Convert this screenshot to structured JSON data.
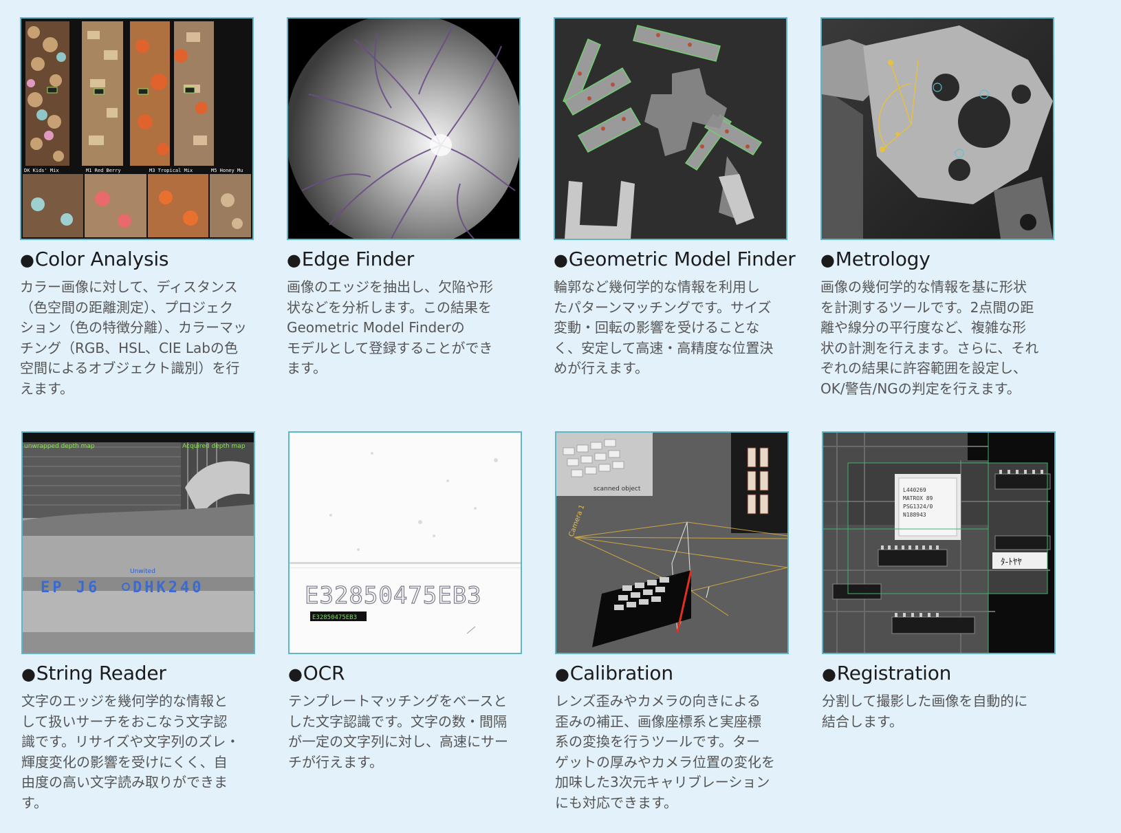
{
  "cards": [
    {
      "title": "Color Analysis",
      "image": "color-analysis-cereal-image",
      "image_labels": [
        "DK Kids' Mix",
        "M1 Red Berry",
        "M3 Tropical Mix",
        "M5 Honey Mu"
      ],
      "description": [
        "カラー画像に対して、ディスタンス",
        "（色空間の距離測定）、プロジェク",
        "ション（色の特徴分離）、カラーマッ",
        "チング（RGB、HSL、CIE Labの色",
        "空間によるオブジェクト識別）を行",
        "えます。"
      ]
    },
    {
      "title": "Edge Finder",
      "image": "retina-vessel-image",
      "image_labels": [],
      "description": [
        "画像のエッジを抽出し、欠陥や形",
        "状などを分析します。この結果を",
        "Geometric Model Finderの",
        "モデルとして登録することができ",
        "ます。"
      ]
    },
    {
      "title": "Geometric Model Finder",
      "image": "metal-brackets-image",
      "image_labels": [],
      "description": [
        "輪郭など幾何学的な情報を利用し",
        "たパターンマッチングです。サイズ",
        "変動・回転の影響を受けることな",
        "く、安定して高速・高精度な位置決",
        "めが行えます。"
      ]
    },
    {
      "title": "Metrology",
      "image": "metal-part-measurement-image",
      "image_labels": [],
      "description": [
        "画像の幾何学的な情報を基に形状",
        "を計測するツールです。2点間の距",
        "離や線分の平行度など、複雑な形",
        "状の計測を行えます。さらに、それ",
        "ぞれの結果に許容範囲を設定し、",
        "OK/警告/NGの判定を行えます。"
      ]
    },
    {
      "title": "String Reader",
      "image": "tire-depth-map-image",
      "image_labels": [
        "unwrapped depth map",
        "Acquired depth map",
        "Unwited",
        "EP J6",
        "DHK240"
      ],
      "description": [
        "文字のエッジを幾何学的な情報と",
        "して扱いサーチをおこなう文字認",
        "識です。リサイズや文字列のズレ・",
        "輝度変化の影響を受けにくく、自",
        "由度の高い文字読み取りができま",
        "す。"
      ]
    },
    {
      "title": "OCR",
      "image": "ocr-dot-matrix-image",
      "image_labels": [
        "E32850475EB3",
        "E32850475EB3"
      ],
      "description": [
        "テンプレートマッチングをベースと",
        "した文字認識です。文字の数・間隔",
        "が一定の文字列に対し、高速にサー",
        "チが行えます。"
      ]
    },
    {
      "title": "Calibration",
      "image": "camera-calibration-3d-image",
      "image_labels": [
        "scanned object",
        "Camera 1"
      ],
      "description": [
        "レンズ歪みやカメラの向きによる",
        "歪みの補正、画像座標系と実座標",
        "系の変換を行うツールです。ター",
        "ゲットの厚みやカメラ位置の変化を",
        "加味した3次元キャリブレーション",
        "にも対応できます。"
      ]
    },
    {
      "title": "Registration",
      "image": "circuit-board-mosaic-image",
      "image_labels": [
        "L440269",
        "MATROX 89",
        "PSG1324/0",
        "N188943",
        "ﾀ-ﾄﾔﾔ"
      ],
      "description": [
        "分割して撮影した画像を自動的に",
        "結合します。"
      ]
    }
  ],
  "bullet": "●"
}
